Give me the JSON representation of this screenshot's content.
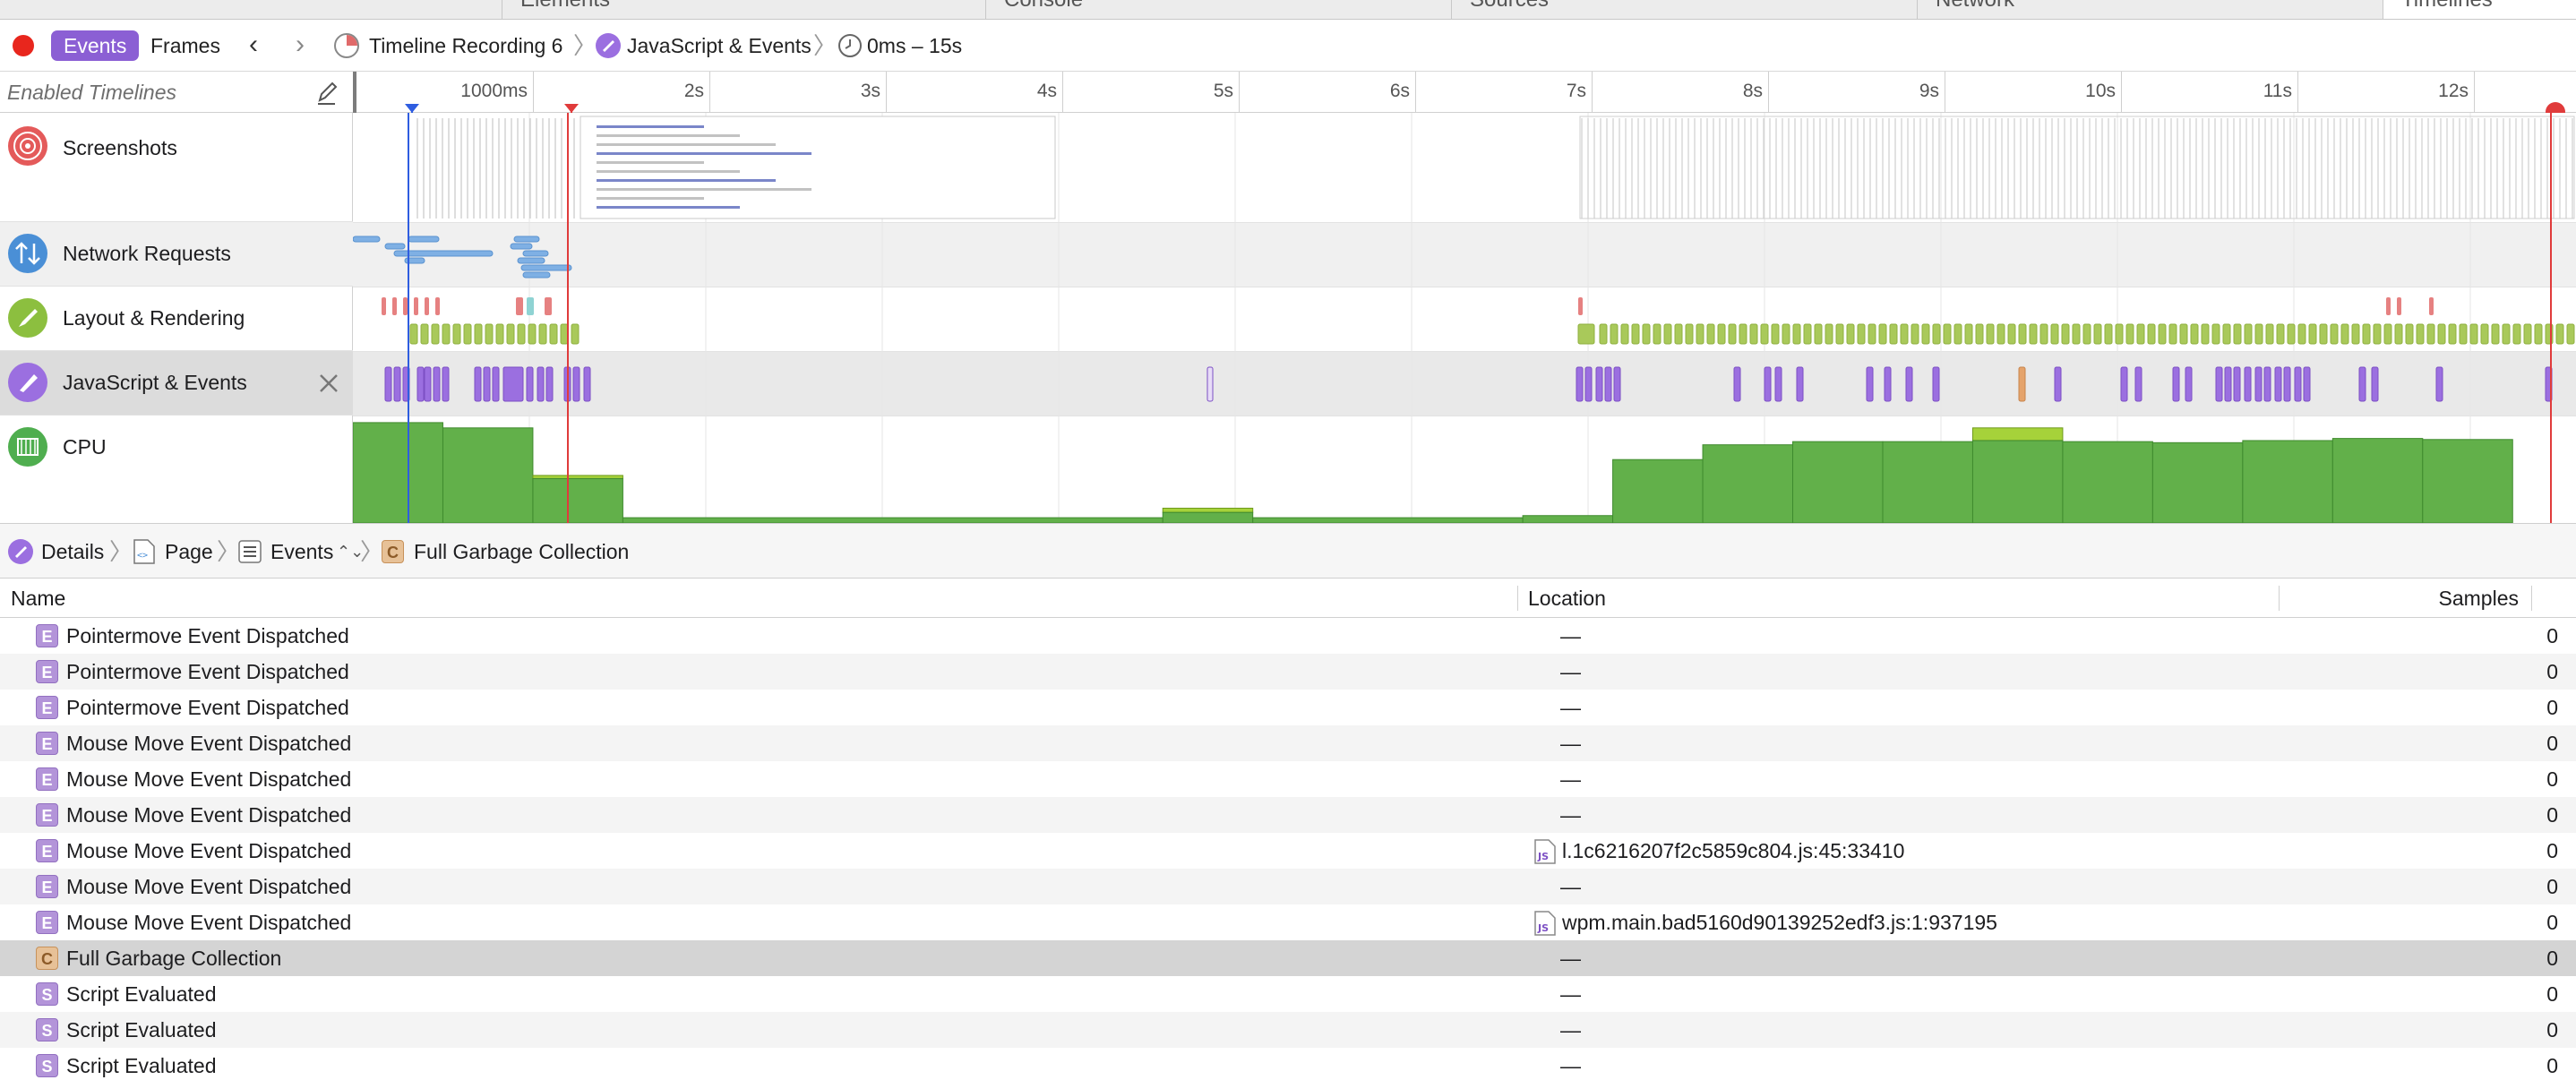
{
  "tab_strip": {
    "tabs": [
      "Elements",
      "Console",
      "Sources",
      "Network",
      "Timelines"
    ]
  },
  "toolbar": {
    "events_label": "Events",
    "frames_label": "Frames",
    "recording_label": "Timeline Recording 6",
    "track_crumb": "JavaScript & Events",
    "range_label": "0ms – 15s"
  },
  "timeline_header": {
    "enabled_label": "Enabled Timelines",
    "ticks": [
      "1000ms",
      "2s",
      "3s",
      "4s",
      "5s",
      "6s",
      "7s",
      "8s",
      "9s",
      "10s",
      "11s",
      "12s"
    ]
  },
  "tracks": [
    {
      "label": "Screenshots",
      "icon": "camera-icon",
      "color": "#e45a5a"
    },
    {
      "label": "Network Requests",
      "icon": "network-arrows-icon",
      "color": "#4a8fd6"
    },
    {
      "label": "Layout & Rendering",
      "icon": "brush-icon",
      "color": "#8cbf3f"
    },
    {
      "label": "JavaScript & Events",
      "icon": "script-icon",
      "color": "#9b6fe0",
      "selected": true
    },
    {
      "label": "CPU",
      "icon": "cpu-icon",
      "color": "#4fae4f"
    }
  ],
  "cpu_usage": {
    "units": "fraction of graph height",
    "bars": [
      {
        "start_s": 0.0,
        "end_s": 0.5,
        "value": 0.95,
        "peak": 0.95
      },
      {
        "start_s": 0.5,
        "end_s": 1.0,
        "value": 0.9,
        "peak": 0.9
      },
      {
        "start_s": 1.0,
        "end_s": 1.5,
        "value": 0.42,
        "peak": 0.45
      },
      {
        "start_s": 1.5,
        "end_s": 4.5,
        "value": 0.05,
        "peak": 0.05
      },
      {
        "start_s": 4.5,
        "end_s": 5.0,
        "value": 0.1,
        "peak": 0.14
      },
      {
        "start_s": 5.0,
        "end_s": 6.5,
        "value": 0.05,
        "peak": 0.05
      },
      {
        "start_s": 6.5,
        "end_s": 7.0,
        "value": 0.07,
        "peak": 0.07
      },
      {
        "start_s": 7.0,
        "end_s": 7.5,
        "value": 0.6,
        "peak": 0.6
      },
      {
        "start_s": 7.5,
        "end_s": 8.0,
        "value": 0.74,
        "peak": 0.74
      },
      {
        "start_s": 8.0,
        "end_s": 8.5,
        "value": 0.77,
        "peak": 0.77
      },
      {
        "start_s": 8.5,
        "end_s": 9.0,
        "value": 0.77,
        "peak": 0.77
      },
      {
        "start_s": 9.0,
        "end_s": 9.5,
        "value": 0.78,
        "peak": 0.9
      },
      {
        "start_s": 9.5,
        "end_s": 10.0,
        "value": 0.77,
        "peak": 0.77
      },
      {
        "start_s": 10.0,
        "end_s": 10.5,
        "value": 0.76,
        "peak": 0.76
      },
      {
        "start_s": 10.5,
        "end_s": 11.0,
        "value": 0.78,
        "peak": 0.78
      },
      {
        "start_s": 11.0,
        "end_s": 11.5,
        "value": 0.8,
        "peak": 0.8
      },
      {
        "start_s": 11.5,
        "end_s": 12.0,
        "value": 0.79,
        "peak": 0.79
      }
    ]
  },
  "details": {
    "crumbs": [
      "Details",
      "Page",
      "Events",
      "Full Garbage Collection"
    ]
  },
  "table": {
    "columns": {
      "name": "Name",
      "location": "Location",
      "samples": "Samples"
    },
    "rows": [
      {
        "type": "E",
        "name": "Pointermove Event Dispatched",
        "location": "—",
        "samples": "0"
      },
      {
        "type": "E",
        "name": "Pointermove Event Dispatched",
        "location": "—",
        "samples": "0"
      },
      {
        "type": "E",
        "name": "Pointermove Event Dispatched",
        "location": "—",
        "samples": "0"
      },
      {
        "type": "E",
        "name": "Mouse Move Event Dispatched",
        "location": "—",
        "samples": "0"
      },
      {
        "type": "E",
        "name": "Mouse Move Event Dispatched",
        "location": "—",
        "samples": "0"
      },
      {
        "type": "E",
        "name": "Mouse Move Event Dispatched",
        "location": "—",
        "samples": "0"
      },
      {
        "type": "E",
        "name": "Mouse Move Event Dispatched",
        "location": "l.1c6216207f2c5859c804.js:45:33410",
        "samples": "0",
        "is_file": true
      },
      {
        "type": "E",
        "name": "Mouse Move Event Dispatched",
        "location": "—",
        "samples": "0"
      },
      {
        "type": "E",
        "name": "Mouse Move Event Dispatched",
        "location": "wpm.main.bad5160d90139252edf3.js:1:937195",
        "samples": "0",
        "is_file": true
      },
      {
        "type": "C",
        "name": "Full Garbage Collection",
        "location": "—",
        "samples": "0",
        "selected": true
      },
      {
        "type": "S",
        "name": "Script Evaluated",
        "location": "—",
        "samples": "0"
      },
      {
        "type": "S",
        "name": "Script Evaluated",
        "location": "—",
        "samples": "0"
      },
      {
        "type": "S",
        "name": "Script Evaluated",
        "location": "—",
        "samples": "0"
      }
    ]
  }
}
